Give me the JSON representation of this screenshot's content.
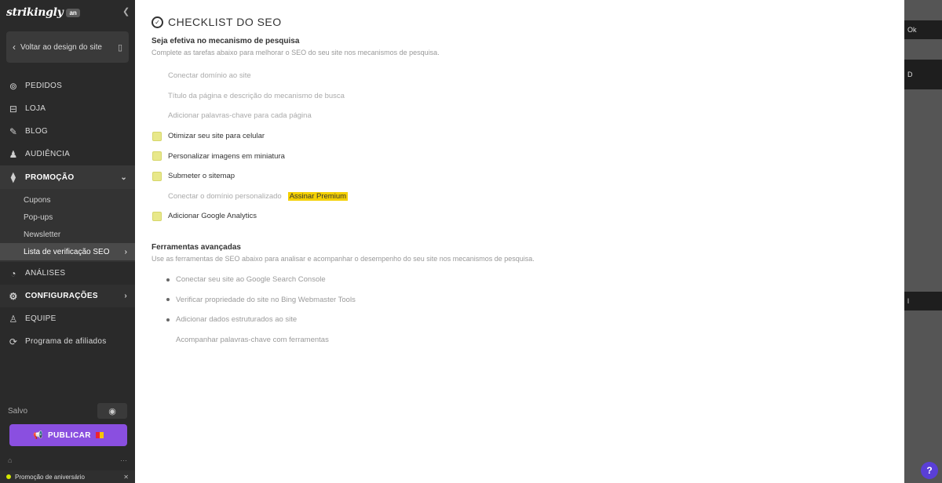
{
  "app": {
    "logo_text": "strikingly",
    "logo_badge": "an"
  },
  "sidebar": {
    "back_label": "Voltar ao design do site",
    "nav": [
      {
        "label": "PEDIDOS",
        "icon": "receipt-icon"
      },
      {
        "label": "LOJA",
        "icon": "store-icon"
      },
      {
        "label": "BLOG",
        "icon": "blog-icon"
      },
      {
        "label": "AUDIÊNCIA",
        "icon": "audience-icon"
      }
    ],
    "promo": {
      "label": "PROMOÇÃO",
      "icon": "megaphone-icon",
      "sub": [
        "Cupons",
        "Pop-ups",
        "Newsletter",
        "Lista de verificação SEO"
      ]
    },
    "after_promo": [
      {
        "label": "ANÁLISES",
        "icon": "analytics-icon"
      },
      {
        "label": "CONFIGURAÇÕES",
        "icon": "gear-icon"
      },
      {
        "label": "EQUIPE",
        "icon": "team-icon"
      },
      {
        "label": "Programa de afiliados",
        "icon": "affiliate-icon"
      }
    ],
    "saved_label": "Salvo",
    "publish_label": "PUBLICAR",
    "promo_bar_text": "Promoção de aniversário"
  },
  "main": {
    "title": "CHECKLIST DO SEO",
    "section1": {
      "title": "Seja efetiva no mecanismo de pesquisa",
      "desc": "Complete as tarefas abaixo para melhorar o SEO do seu site nos mecanismos de pesquisa."
    },
    "checklist": [
      {
        "label": "Conectar domínio ao site",
        "done": true
      },
      {
        "label": "Título da página e descrição do mecanismo de busca",
        "done": true
      },
      {
        "label": "Adicionar palavras-chave para cada página",
        "done": true
      },
      {
        "label": "Otimizar seu site para celular",
        "done": false
      },
      {
        "label": "Personalizar imagens em miniatura",
        "done": false
      },
      {
        "label": "Submeter o sitemap",
        "done": false
      },
      {
        "label": "Conectar o domínio personalizado",
        "done": true,
        "tag": "Assinar Premium"
      },
      {
        "label": "Adicionar Google Analytics",
        "done": false
      }
    ],
    "section2": {
      "title": "Ferramentas avançadas",
      "desc": "Use as ferramentas de SEO abaixo para analisar e acompanhar o desempenho do seu site nos mecanismos de pesquisa."
    },
    "tools": [
      "Conectar seu site ao Google Search Console",
      "Verificar propriedade do site no Bing Webmaster Tools",
      "Adicionar dados estruturados ao site",
      "Acompanhar palavras-chave com ferramentas"
    ]
  },
  "right_panel": {
    "pill_top": "Ok",
    "pill_mid": "D",
    "pill_bottom": "l"
  },
  "help_label": "?"
}
